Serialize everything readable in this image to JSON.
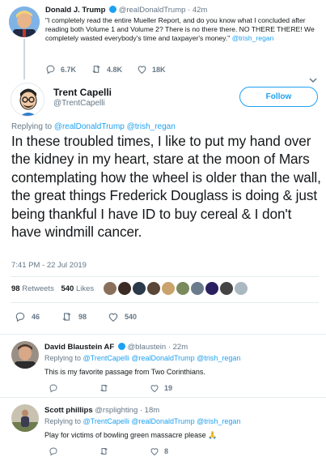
{
  "parent_tweet": {
    "name": "Donald J. Trump",
    "handle": "@realDonaldTrump",
    "time": "· 42m",
    "text": "\"I completely read the entire Mueller Report, and do you know what I concluded after reading both Volume 1 and Volume 2? There is no there there. NO THERE THERE! We completely wasted everybody's time and taxpayer's money.\"",
    "mention": "@trish_regan",
    "replies": "6.7K",
    "retweets": "4.8K",
    "likes": "18K"
  },
  "main_tweet": {
    "name": "Trent Capelli",
    "handle": "@TrentCapelli",
    "follow_label": "Follow",
    "replying_prefix": "Replying to ",
    "replying_to": "@realDonaldTrump @trish_regan",
    "text": "In these troubled times, I like to put my hand over the kidney in my heart, stare at the moon of Mars contemplating how the wheel is older than the wall, the great things Frederick Douglass is doing & just being thankful I have ID to buy cereal & I don't have windmill cancer.",
    "timestamp": "7:41 PM - 22 Jul 2019",
    "retweet_count": "98",
    "retweet_label": "Retweets",
    "like_count": "540",
    "like_label": "Likes",
    "replies": "46",
    "retweets": "98",
    "likes": "540",
    "liker_colors": [
      "#8a6f5a",
      "#3b2b24",
      "#2b3a4a",
      "#5a4636",
      "#c9a36b",
      "#7a8a5c",
      "#6a7b8c",
      "#2a2060",
      "#444444",
      "#aab8c2"
    ]
  },
  "replies": [
    {
      "name": "David Blaustein AF",
      "handle": "@blaustein",
      "time": "· 22m",
      "replying_prefix": "Replying to ",
      "replying_to": "@TrentCapelli @realDonaldTrump @trish_regan",
      "text": "This is my favorite passage from Two Corinthians.",
      "replies": "",
      "retweets": "",
      "likes": "19"
    },
    {
      "name": "Scott phillips",
      "handle": "@rsplighting",
      "time": "· 18m",
      "replying_prefix": "Replying to ",
      "replying_to": "@TrentCapelli @realDonaldTrump @trish_regan",
      "text": "Play for victims of bowling green massacre please 🙏",
      "replies": "",
      "retweets": "",
      "likes": "8"
    }
  ],
  "colors": {
    "accent": "#1da1f2",
    "muted": "#657786",
    "text": "#14171a",
    "divider": "#e6ecf0"
  }
}
